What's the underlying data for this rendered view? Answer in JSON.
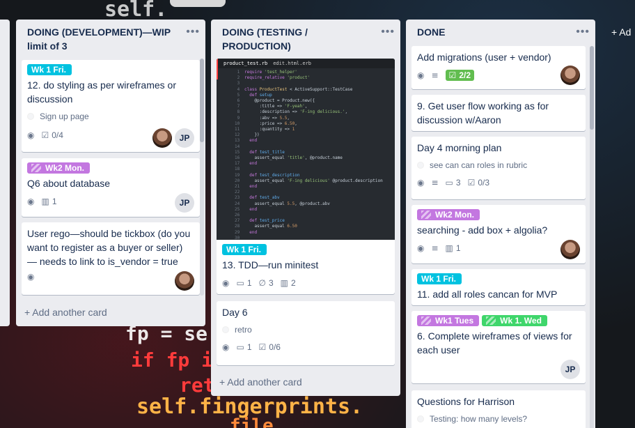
{
  "lists": [
    {
      "title": "DOING (DEVELOPMENT)—WIP limit of 3",
      "menu": "•••",
      "add_card": "+ Add another card",
      "cards": [
        {
          "labels": [
            "Wk 1 Fri."
          ],
          "title": "12. do styling as per wireframes or discussion",
          "sub": "Sign up page",
          "badges": {
            "checklist": "0/4"
          },
          "members": [
            "JP"
          ]
        },
        {
          "labels": [
            "Wk2 Mon."
          ],
          "title": "Q6 about database",
          "badges": {
            "attachments": "1"
          },
          "members": [
            "JP"
          ]
        },
        {
          "title": "User rego—should be tickbox (do you want to register as a buyer or seller) — needs to link to is_vendor = true"
        }
      ]
    },
    {
      "title": "DOING (TESTING / PRODUCTION)",
      "menu": "•••",
      "add_card": "+ Add another card",
      "cards": [
        {
          "cover": {
            "tab1": "product_test.rb",
            "tab2": "edit.html.erb"
          },
          "labels": [
            "Wk 1 Fri."
          ],
          "title": "13. TDD—run minitest",
          "badges": {
            "comments": "1",
            "attachments": "3",
            "cards": "2"
          }
        },
        {
          "title": "Day 6",
          "sub": "retro",
          "badges": {
            "comments": "1",
            "checklist": "0/6"
          }
        }
      ]
    },
    {
      "title": "DONE",
      "menu": "•••",
      "cards": [
        {
          "title": "Add migrations (user + vendor)",
          "badges": {
            "checklist": "2/2"
          }
        },
        {
          "title": "9. Get user flow working as for discussion w/Aaron"
        },
        {
          "title": "Day 4 morning plan",
          "sub": "see can can roles in rubric",
          "badges": {
            "comments": "3",
            "checklist": "0/3"
          }
        },
        {
          "labels": [
            "Wk2 Mon."
          ],
          "title": "searching - add box + algolia?",
          "badges": {
            "cards": "1"
          }
        },
        {
          "labels": [
            "Wk 1 Fri."
          ],
          "title": "11. add all roles cancan for MVP"
        },
        {
          "labels": [
            "Wk1 Tues",
            "Wk 1. Wed"
          ],
          "title": "6. Complete wireframes of views for each user",
          "members": [
            "JP"
          ]
        },
        {
          "title": "Questions for Harrison",
          "sub": "Testing: how many levels?"
        }
      ]
    }
  ],
  "add_list": "+ Ad",
  "colors": {
    "cyan": "#00c2e0",
    "purple": "#c377e0",
    "green": "#3fd66b",
    "check_done": "#61bd4f",
    "list_bg": "#ebecf0"
  },
  "icons": {
    "watch": "eye-icon",
    "desc": "description-icon",
    "checklist": "checklist-icon",
    "comment": "comment-icon",
    "attachment": "paperclip-icon",
    "cards": "card-icon",
    "add": "plus-icon"
  }
}
